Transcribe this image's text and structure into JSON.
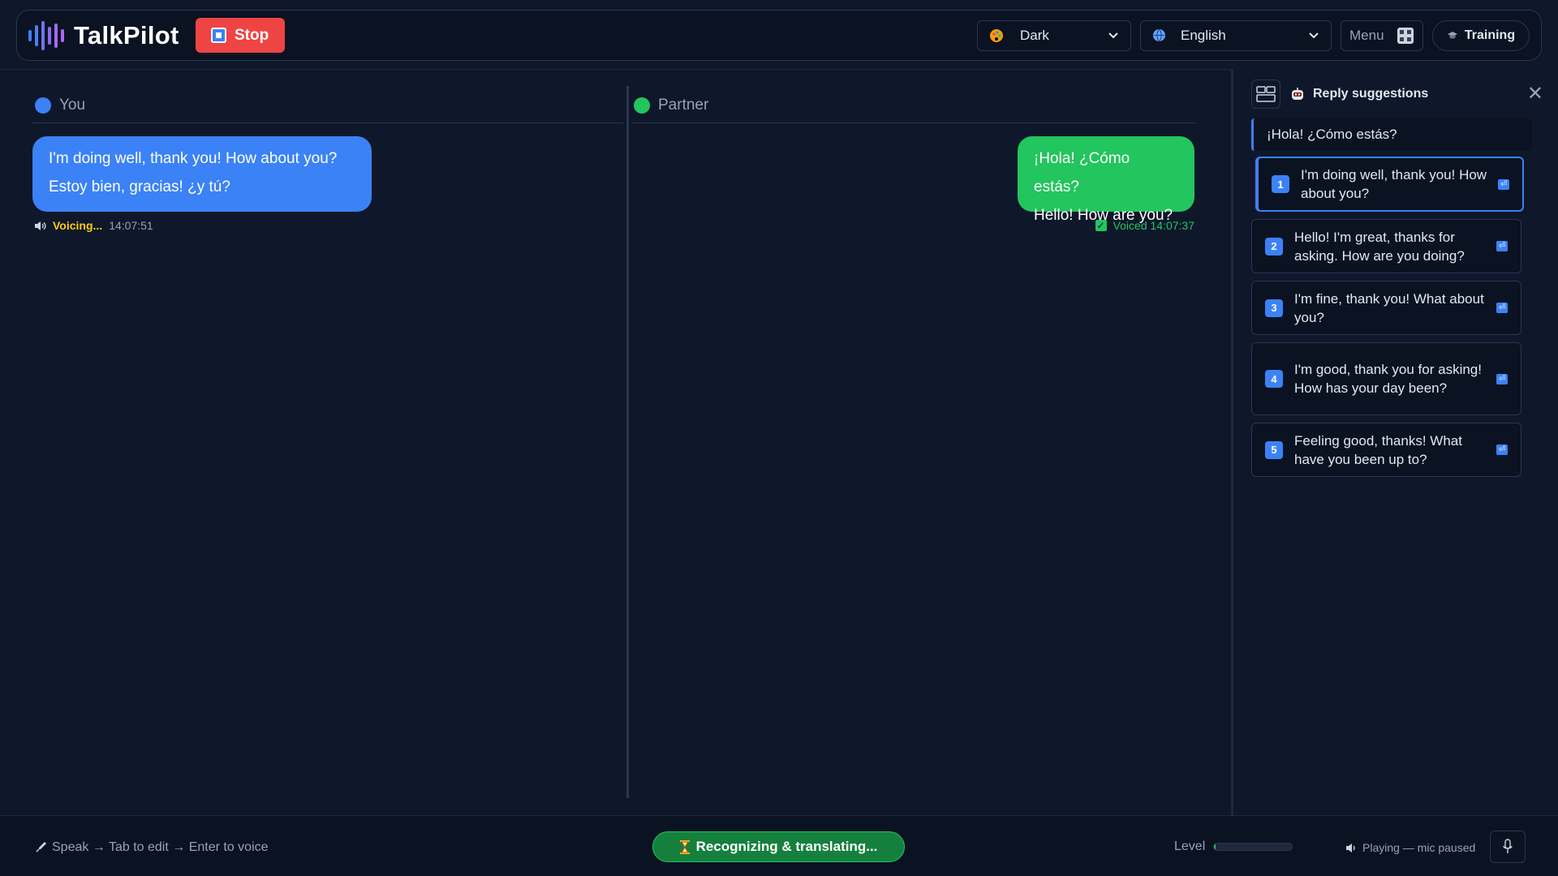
{
  "app": {
    "name": "TalkPilot",
    "stop_label": "Stop"
  },
  "header": {
    "theme": "Dark",
    "language": "English",
    "menu_label": "Menu",
    "training_label": "Training"
  },
  "panes": {
    "you": {
      "label": "You",
      "dot_color": "#3b82f6"
    },
    "partner": {
      "label": "Partner",
      "dot_color": "#22c55e"
    }
  },
  "messages": {
    "you": {
      "line1": "I'm doing well, thank you! How about you?",
      "line2": "Estoy bien, gracias! ¿y tú?",
      "status": "Voicing...",
      "time": "14:07:51"
    },
    "partner": {
      "line1": "¡Hola! ¿Cómo estás?",
      "line2": "Hello! How are you?",
      "status": "Voiced 14:07:37"
    }
  },
  "sidebar": {
    "title": "Reply suggestions",
    "source_text": "¡Hola! ¿Cómo estás?",
    "suggestions": [
      {
        "num": "1",
        "text": "I'm doing well, thank you! How about you?"
      },
      {
        "num": "2",
        "text": "Hello! I'm great, thanks for asking. How are you doing?"
      },
      {
        "num": "3",
        "text": "I'm fine, thank you! What about you?"
      },
      {
        "num": "4",
        "text": "I'm good, thank you for asking! How has your day been?"
      },
      {
        "num": "5",
        "text": "Feeling good, thanks! What have you been up to?"
      }
    ]
  },
  "footer": {
    "hint": "Speak → Tab to edit → Enter to voice",
    "status": "Recognizing & translating...",
    "level_label": "Level",
    "level_value": 0.02,
    "playing": "Playing — mic paused"
  },
  "colors": {
    "background": "#0f172a",
    "accent_blue": "#3b82f6",
    "accent_green": "#22c55e",
    "stop_red": "#ef4444",
    "voicing_yellow": "#facc15"
  }
}
